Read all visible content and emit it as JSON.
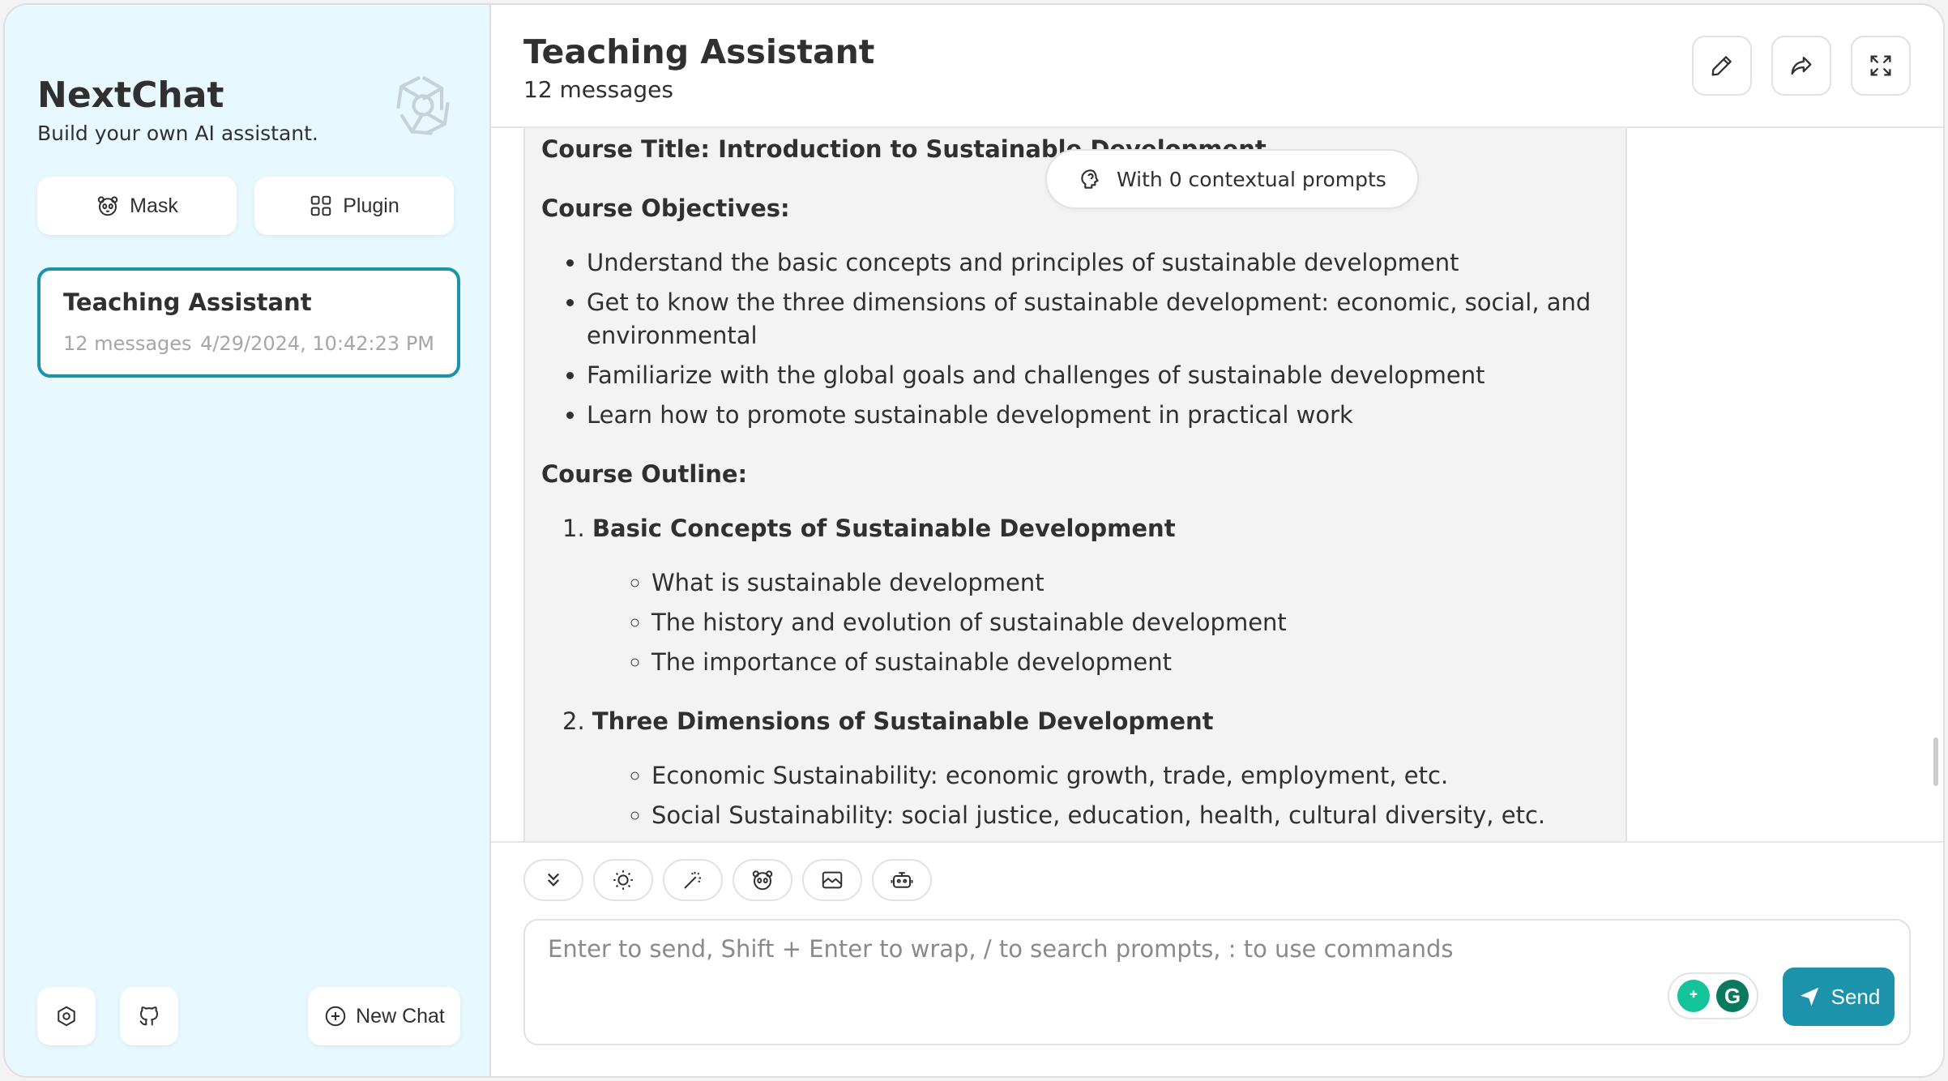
{
  "sidebar": {
    "title": "NextChat",
    "subtitle": "Build your own AI assistant.",
    "mask_label": "Mask",
    "plugin_label": "Plugin",
    "chats": [
      {
        "title": "Teaching Assistant",
        "count": "12 messages",
        "time": "4/29/2024, 10:42:23 PM",
        "selected": true
      }
    ],
    "new_chat_label": "New Chat",
    "icons": {
      "settings": "settings-icon",
      "github": "github-icon",
      "logo": "openai-logo-icon"
    }
  },
  "header": {
    "title": "Teaching Assistant",
    "subtitle": "12 messages",
    "actions": [
      "edit-icon",
      "share-icon",
      "fullscreen-icon"
    ]
  },
  "context_pill": {
    "label": "With 0 contextual prompts"
  },
  "message": {
    "course_title": "Course Title: Introduction to Sustainable Development",
    "objectives_heading": "Course Objectives:",
    "objectives": [
      "Understand the basic concepts and principles of sustainable development",
      "Get to know the three dimensions of sustainable development: economic, social, and environmental",
      "Familiarize with the global goals and challenges of sustainable development",
      "Learn how to promote sustainable development in practical work"
    ],
    "outline_heading": "Course Outline:",
    "outline": [
      {
        "num": "1.",
        "title": "Basic Concepts of Sustainable Development",
        "items": [
          "What is sustainable development",
          "The history and evolution of sustainable development",
          "The importance of sustainable development"
        ]
      },
      {
        "num": "2.",
        "title": "Three Dimensions of Sustainable Development",
        "items": [
          "Economic Sustainability: economic growth, trade, employment, etc.",
          "Social Sustainability: social justice, education, health, cultural diversity, etc."
        ]
      }
    ]
  },
  "toolbar": {
    "tools": [
      "scroll-down-icon",
      "theme-icon",
      "prompt-icon",
      "mask-icon",
      "image-icon",
      "bot-icon"
    ]
  },
  "input": {
    "placeholder": "Enter to send, Shift + Enter to wrap, / to search prompts, : to use commands",
    "value": "",
    "send_label": "Send"
  },
  "colors": {
    "accent": "#1d93ab",
    "sidebar_bg": "#e7f8ff",
    "message_bg": "#f3f3f3"
  }
}
